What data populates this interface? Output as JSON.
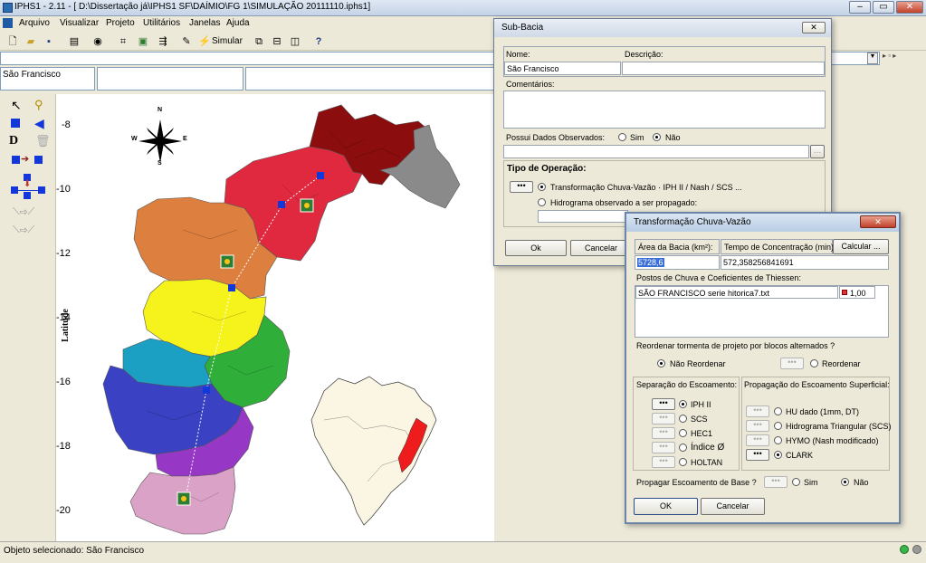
{
  "app": {
    "title": "IPHS1 - 2.11 - [ D:\\Dissertação já\\IPHS1 SF\\DAÍMIO\\FG 1\\SIMULAÇÃO 20111110.iphs1]",
    "menu": [
      "Arquivo",
      "Visualizar",
      "Projeto",
      "Utilitários",
      "Janelas",
      "Ajuda"
    ],
    "simulate_label": "Simular",
    "help_glyph": "?",
    "object_field": "São Francisco",
    "status": "Objeto selecionado: São Francisco"
  },
  "map": {
    "y_axis_label": "Latitude",
    "y_ticks": [
      "-8",
      "-10",
      "-12",
      "-14",
      "-16",
      "-18",
      "-20"
    ],
    "compass": {
      "n": "N",
      "s": "S",
      "e": "E",
      "w": "W"
    },
    "colors": {
      "darkred": "#8b0d0d",
      "gray": "#8a8a8a",
      "crimson": "#e0293f",
      "orange": "#dd7f3e",
      "yellow": "#f6f21b",
      "green": "#2fae3a",
      "teal": "#1b9fc3",
      "blue": "#3a41c2",
      "purple": "#9637c6",
      "pink": "#dba2c8",
      "highlight": "#ee1c1c"
    }
  },
  "subbacia": {
    "title": "Sub-Bacia",
    "close": "✕",
    "nome_label": "Nome:",
    "nome_value": "São Francisco",
    "descricao_label": "Descrição:",
    "comentarios_label": "Comentários:",
    "possui_label": "Possui Dados Observados:",
    "sim": "Sim",
    "nao": "Não",
    "tipo_label": "Tipo de Operação:",
    "op1": "Transformação Chuva-Vazão · IPH II / Nash / SCS ...",
    "op2": "Hidrograma observado a ser propagado:",
    "ok": "Ok",
    "cancel": "Cancelar"
  },
  "transf": {
    "title": "Transformação Chuva-Vazão",
    "close": "✕",
    "area_label": "Área da Bacia (km²):",
    "area_value": "5728,6",
    "tc_label": "Tempo de Concentração (min):",
    "calc": "Calcular ...",
    "tc_value": "572,358256841691",
    "postos_label": "Postos de Chuva e Coeficientes de Thiessen:",
    "posto_name": "SÃO FRANCISCO serie hitorica7.txt",
    "posto_coef": "1,00",
    "reordenar_q": "Reordenar tormenta de projeto por blocos alternados ?",
    "nao_reordenar": "Não Reordenar",
    "reordenar": "Reordenar",
    "separacao": "Separação do Escoamento:",
    "sep_items": [
      "IPH II",
      "SCS",
      "HEC1",
      "Índice Ø",
      "HOLTAN"
    ],
    "propagacao": "Propagação do Escoamento Superficial:",
    "prop_items": [
      "HU dado (1mm, DT)",
      "Hidrograma Triangular (SCS)",
      "HYMO (Nash modificado)",
      "CLARK"
    ],
    "base_q": "Propagar Escoamento de Base ?",
    "sim": "Sim",
    "nao": "Não",
    "ok": "OK",
    "cancel": "Cancelar"
  }
}
